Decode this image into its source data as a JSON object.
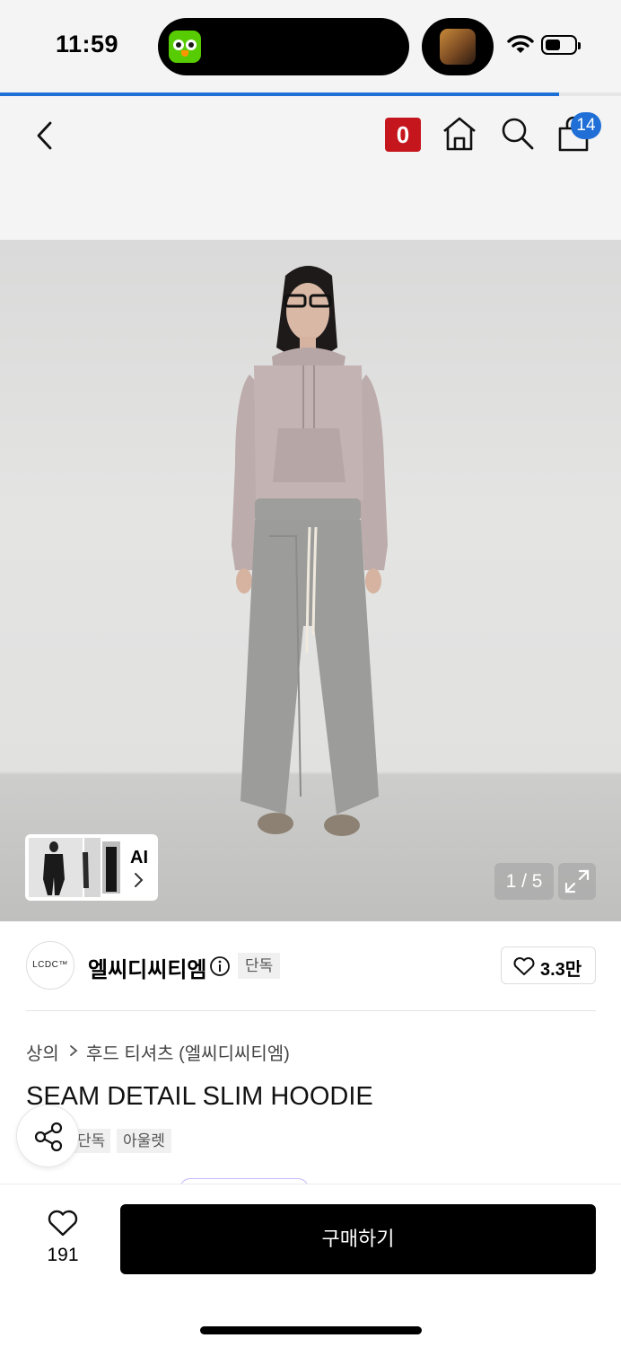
{
  "status_bar": {
    "time": "11:59"
  },
  "page_progress": 0.9,
  "nav": {
    "badge_label": "0",
    "cart_count": "14"
  },
  "gallery": {
    "counter": "1 / 5",
    "ai_label": "AI"
  },
  "brand": {
    "logo_text": "LCDC™",
    "name": "엘씨디씨티엠",
    "badge": "단독",
    "likes": "3.3만"
  },
  "product": {
    "breadcrumb": [
      "상의",
      "후드 티셔츠 (엘씨디씨티엠)"
    ],
    "title": "SEAM DETAIL SLIM HOODIE",
    "tags": [
      "단독",
      "아울렛"
    ]
  },
  "bottom": {
    "wishlist_count": "191",
    "buy_label": "구매하기"
  },
  "colors": {
    "accent_blue": "#1f6fd6",
    "badge_red": "#c4161c",
    "primary_black": "#000000"
  }
}
